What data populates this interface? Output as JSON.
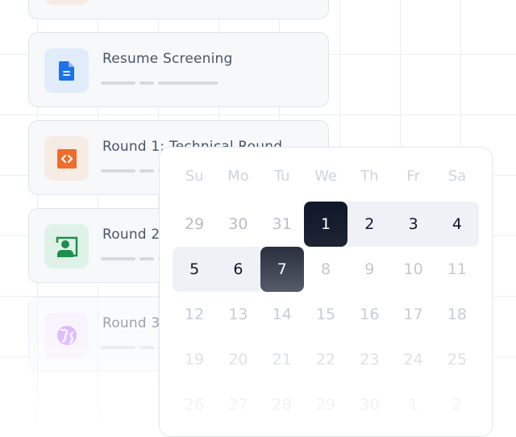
{
  "stages": [
    {
      "title": "",
      "icon": "code-icon",
      "accent": "#f07030",
      "bg": "#f6ece4"
    },
    {
      "title": "Resume Screening",
      "icon": "document-icon",
      "accent": "#1a73e8",
      "bg": "#e1ecfb"
    },
    {
      "title": "Round 1: Technical Round",
      "icon": "code-icon",
      "accent": "#ef6c2a",
      "bg": "#f6ece4"
    },
    {
      "title": "Round 2",
      "icon": "presentation-person-icon",
      "accent": "#1e8e4e",
      "bg": "#dff2e7"
    },
    {
      "title": "Round 3",
      "icon": "globe-icon",
      "accent": "#c084fc",
      "bg": "#f3ecfd"
    }
  ],
  "calendar": {
    "weekdays": [
      "Su",
      "Mo",
      "Tu",
      "We",
      "Th",
      "Fr",
      "Sa"
    ],
    "weeks": [
      [
        "29",
        "30",
        "31",
        "1",
        "2",
        "3",
        "4"
      ],
      [
        "5",
        "6",
        "7",
        "8",
        "9",
        "10",
        "11"
      ],
      [
        "12",
        "13",
        "14",
        "15",
        "16",
        "17",
        "18"
      ],
      [
        "19",
        "20",
        "21",
        "22",
        "23",
        "24",
        "25"
      ],
      [
        "26",
        "27",
        "28",
        "29",
        "30",
        "1",
        "2"
      ]
    ],
    "range_start": "1",
    "range_end": "7",
    "colors": {
      "selected_start": "#0f172a",
      "selected_end": "#3b4050",
      "range_bg": "#eef2f7"
    }
  }
}
